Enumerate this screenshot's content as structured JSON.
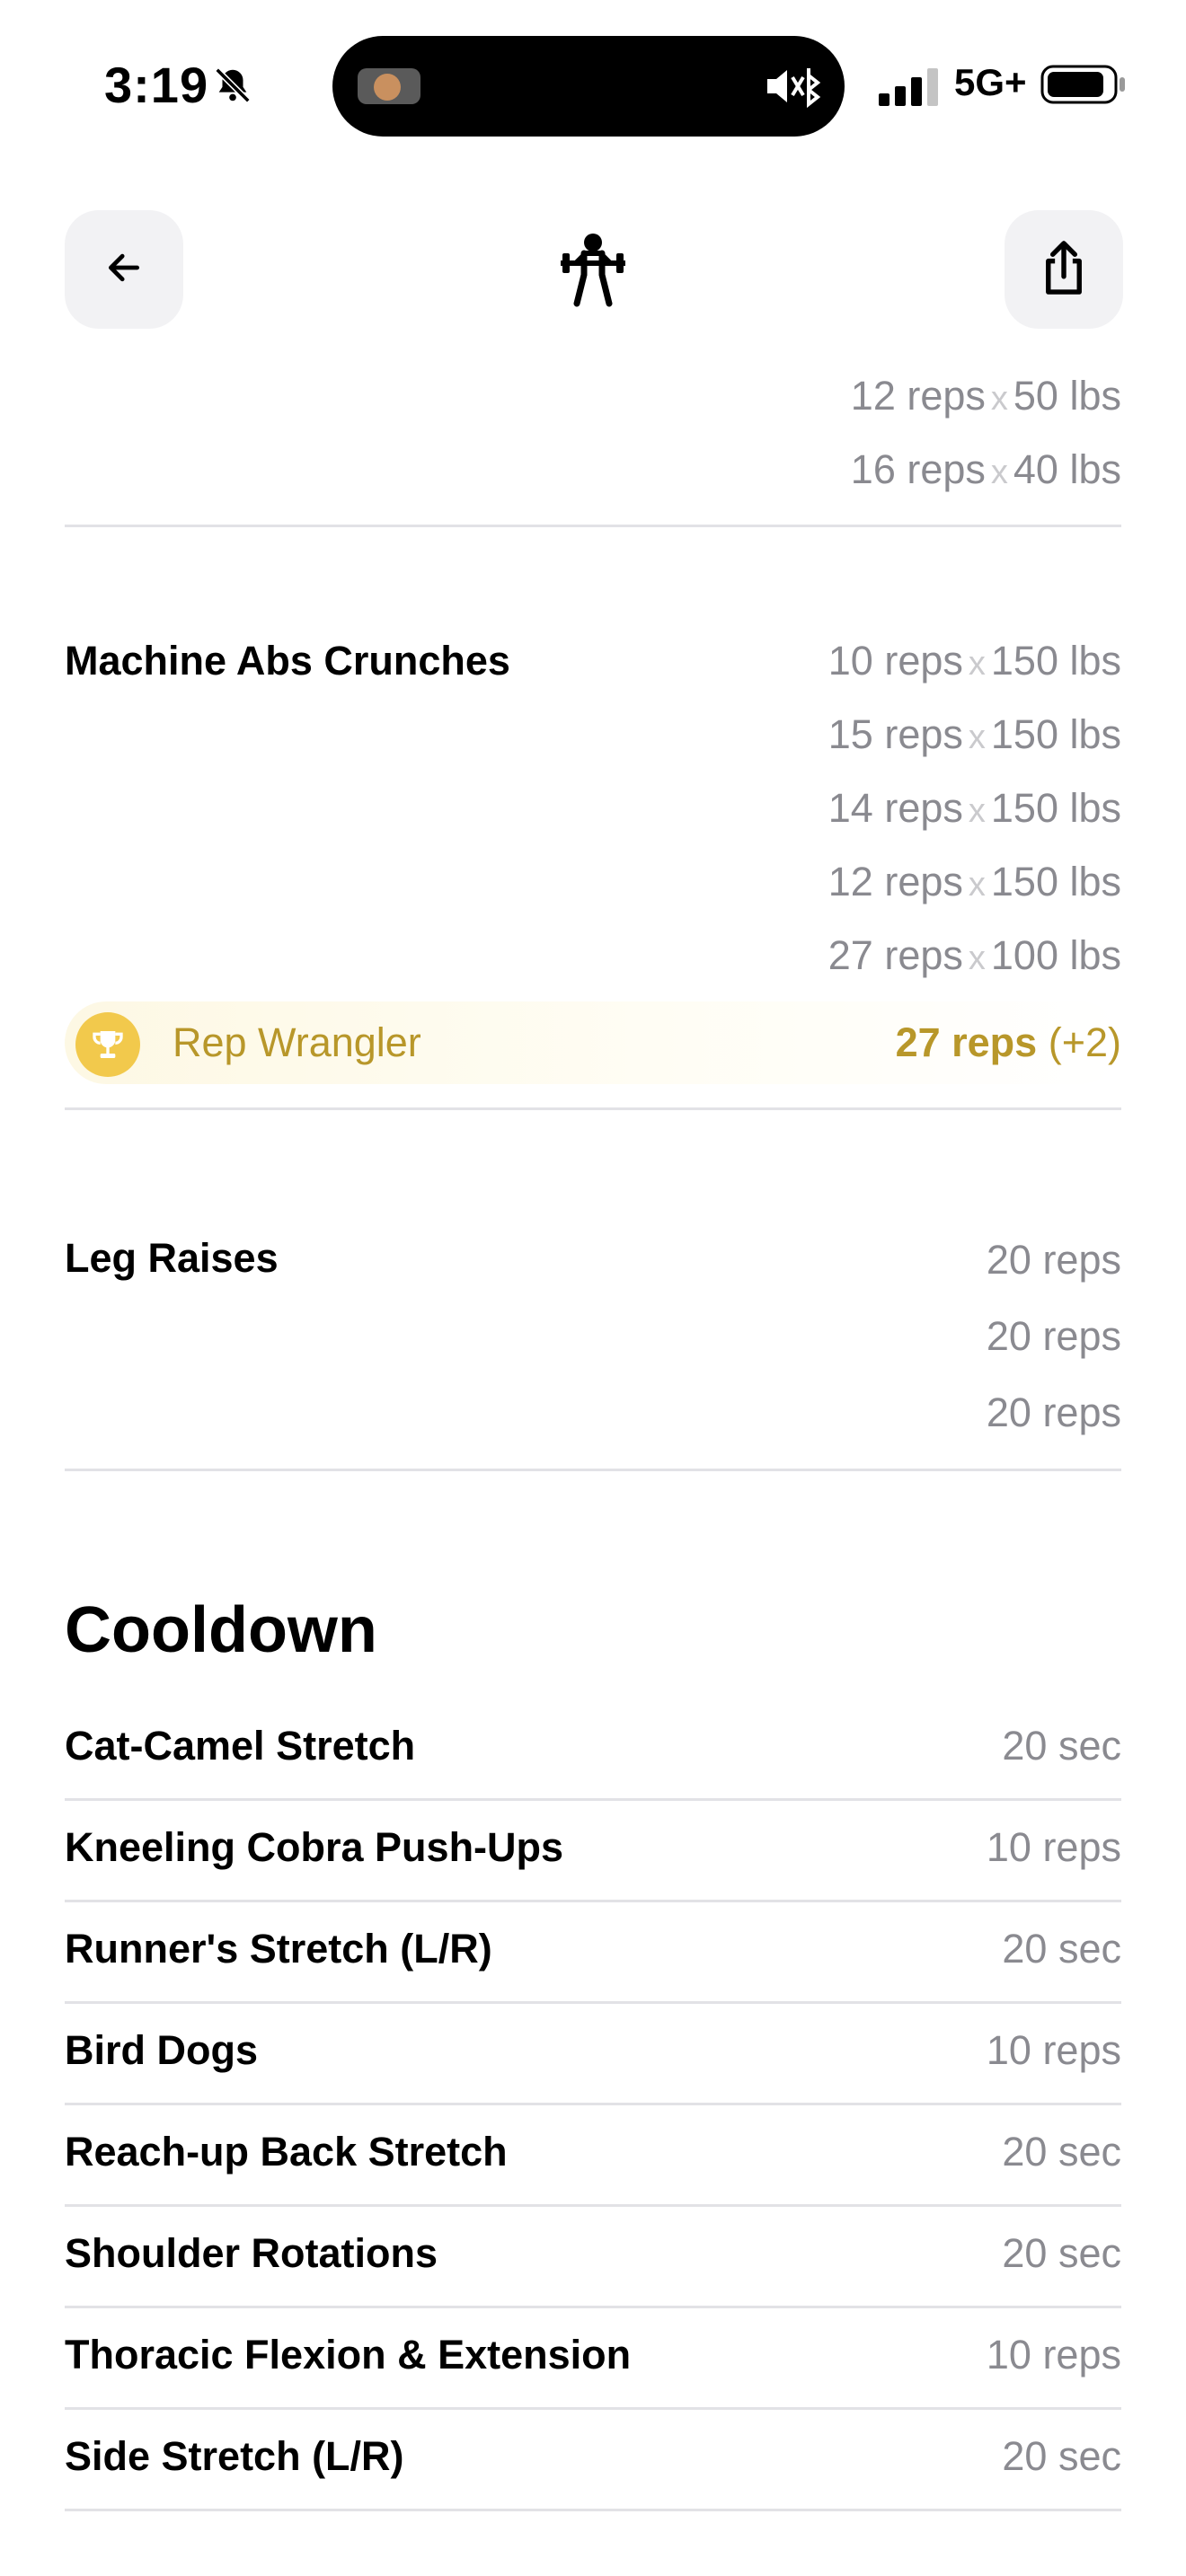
{
  "status_bar": {
    "time": "3:19",
    "network": "5G+"
  },
  "header": {
    "back_icon": "arrow-left-icon",
    "logo_icon": "weightlifter-icon",
    "share_icon": "share-icon"
  },
  "previous_exercise": {
    "sets": [
      {
        "reps": "12 reps",
        "sep": "x",
        "weight": "50 lbs"
      },
      {
        "reps": "16 reps",
        "sep": "x",
        "weight": "40 lbs"
      }
    ]
  },
  "exercises": [
    {
      "name": "Machine Abs Crunches",
      "sets": [
        {
          "reps": "10 reps",
          "sep": "x",
          "weight": "150 lbs"
        },
        {
          "reps": "15 reps",
          "sep": "x",
          "weight": "150 lbs"
        },
        {
          "reps": "14 reps",
          "sep": "x",
          "weight": "150 lbs"
        },
        {
          "reps": "12 reps",
          "sep": "x",
          "weight": "150 lbs"
        },
        {
          "reps": "27 reps",
          "sep": "x",
          "weight": "100 lbs"
        }
      ],
      "award": {
        "icon": "trophy-icon",
        "name": "Rep Wrangler",
        "value": "27 reps",
        "delta": "(+2)"
      }
    },
    {
      "name": "Leg Raises",
      "sets": [
        {
          "reps": "20 reps"
        },
        {
          "reps": "20 reps"
        },
        {
          "reps": "20 reps"
        }
      ]
    }
  ],
  "cooldown": {
    "title": "Cooldown",
    "items": [
      {
        "name": "Cat-Camel Stretch",
        "value": "20 sec"
      },
      {
        "name": "Kneeling Cobra Push-Ups",
        "value": "10 reps"
      },
      {
        "name": "Runner's Stretch (L/R)",
        "value": "20 sec"
      },
      {
        "name": "Bird Dogs",
        "value": "10 reps"
      },
      {
        "name": "Reach-up Back Stretch",
        "value": "20 sec"
      },
      {
        "name": "Shoulder Rotations",
        "value": "20 sec"
      },
      {
        "name": "Thoracic Flexion & Extension",
        "value": "10 reps"
      },
      {
        "name": "Side Stretch (L/R)",
        "value": "20 sec"
      }
    ]
  }
}
